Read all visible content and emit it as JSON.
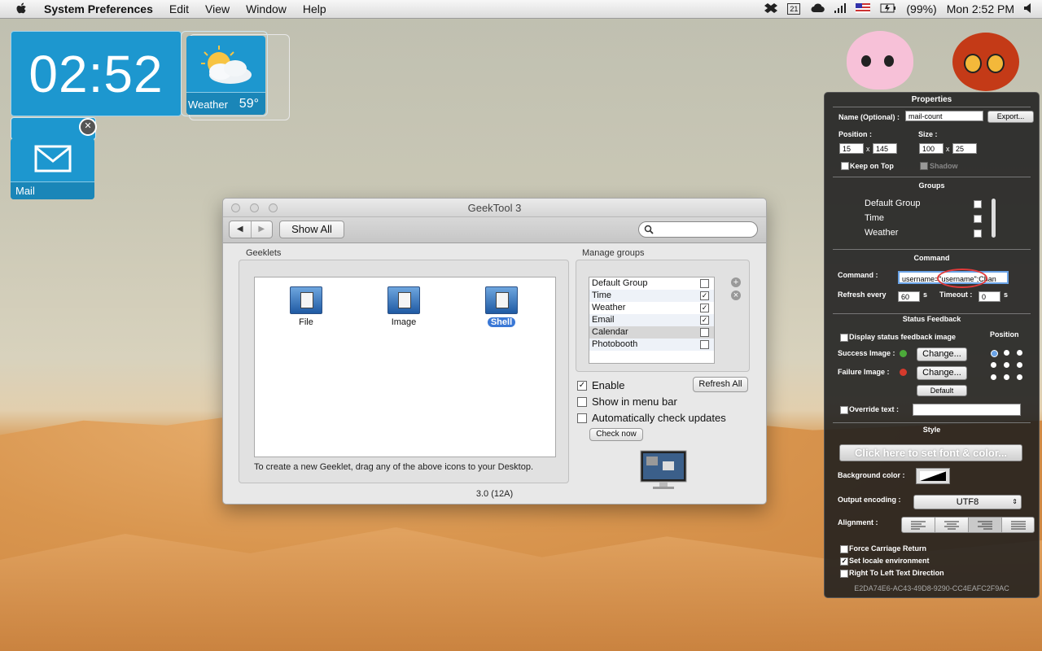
{
  "menubar": {
    "app": "System Preferences",
    "items": [
      "Edit",
      "View",
      "Window",
      "Help"
    ],
    "calendar_day": "21",
    "battery": "(99%)",
    "clock": "Mon 2:52 PM"
  },
  "desktop": {
    "clock": "02:52",
    "weather_label": "Weather",
    "weather_temp": "59°",
    "mail_label": "Mail"
  },
  "window": {
    "title": "GeekTool 3",
    "show_all": "Show All",
    "search_placeholder": "",
    "geeklets_label": "Geeklets",
    "geeklets": [
      {
        "label": "File"
      },
      {
        "label": "Image"
      },
      {
        "label": "Shell"
      }
    ],
    "hint": "To create a new Geeklet, drag any of the above icons to your Desktop.",
    "manage_label": "Manage groups",
    "groups": [
      {
        "label": "Default Group",
        "checked": ""
      },
      {
        "label": "Time",
        "checked": "✓"
      },
      {
        "label": "Weather",
        "checked": "✓"
      },
      {
        "label": "Email",
        "checked": "✓"
      },
      {
        "label": "Calendar",
        "checked": ""
      },
      {
        "label": "Photobooth",
        "checked": ""
      }
    ],
    "enable": "Enable",
    "refresh_all": "Refresh All",
    "show_menu": "Show in menu bar",
    "auto_update": "Automatically check updates",
    "check_now": "Check now",
    "version": "3.0 (12A)"
  },
  "props": {
    "title": "Properties",
    "name_label": "Name (Optional) :",
    "name_value": "mail-count",
    "export": "Export...",
    "position_label": "Position :",
    "size_label": "Size :",
    "pos_x": "15",
    "pos_y": "145",
    "size_w": "100",
    "size_h": "25",
    "x1": "x",
    "x2": "x",
    "keep_top": "Keep on Top",
    "shadow": "Shadow",
    "groups_hd": "Groups",
    "groups": [
      "Default Group",
      "Time",
      "Weather"
    ],
    "command_hd": "Command",
    "command_label": "Command :",
    "command_value": "username=\"username\";Chan",
    "refresh_label": "Refresh every",
    "refresh_value": "60",
    "timeout_label": "Timeout :",
    "timeout_value": "0",
    "s1": "s",
    "s2": "s",
    "status_hd": "Status Feedback",
    "display_status": "Display status feedback image",
    "position_hd": "Position",
    "success_label": "Success Image :",
    "failure_label": "Failure Image :",
    "change": "Change...",
    "default": "Default",
    "override": "Override text :",
    "style_hd": "Style",
    "font_btn": "Click here to set font & color...",
    "bg_label": "Background color :",
    "encoding_label": "Output encoding :",
    "encoding_value": "UTF8",
    "alignment_label": "Alignment :",
    "force_cr": "Force Carriage Return",
    "set_locale": "Set locale environment",
    "rtl": "Right To Left Text Direction",
    "uuid": "E2DA74E6-AC43-49D8-9290-CC4EAFC2F9AC"
  }
}
